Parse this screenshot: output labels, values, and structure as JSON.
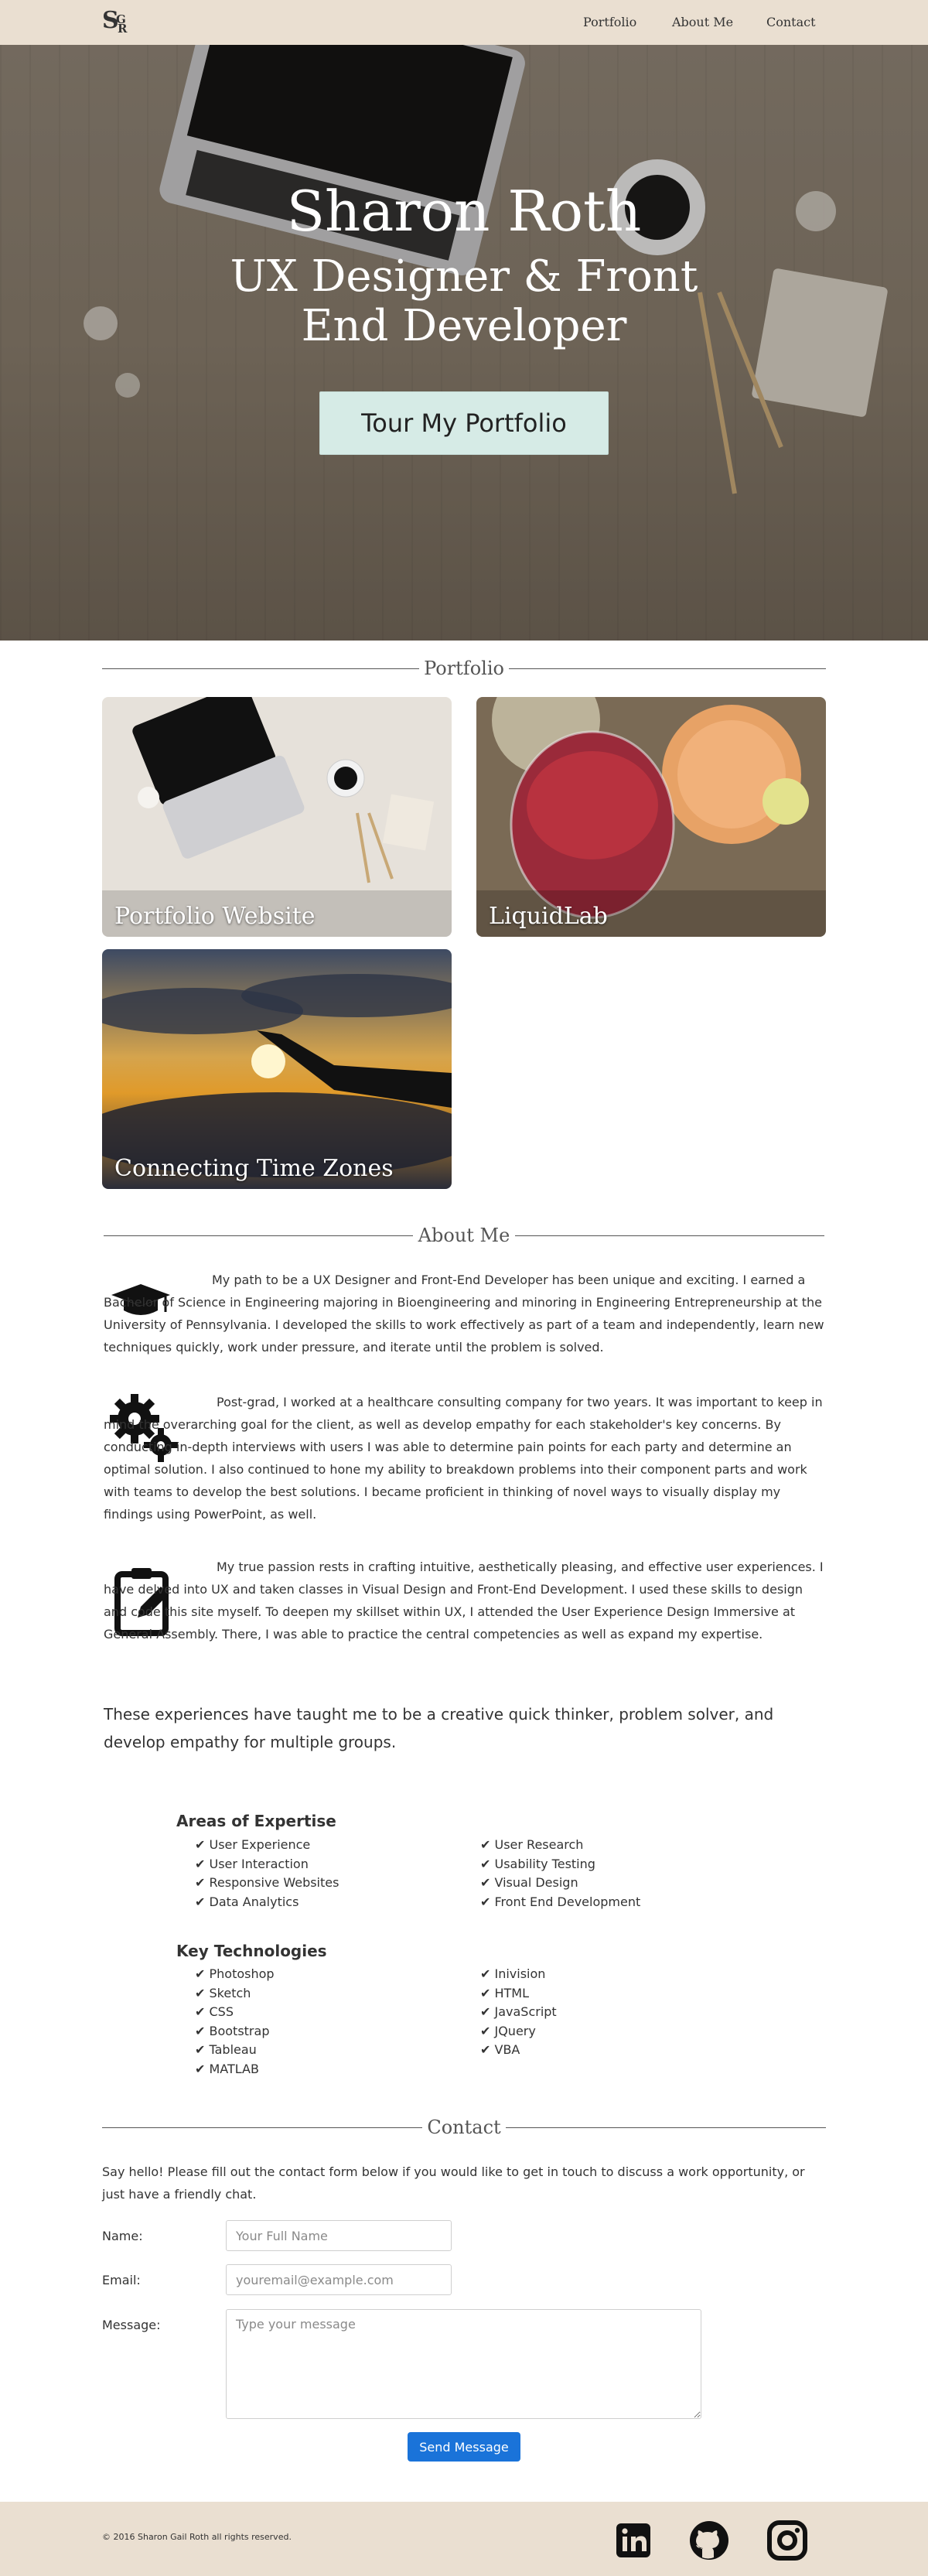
{
  "header": {
    "logo_letters": [
      "S",
      "G",
      "R"
    ],
    "nav": [
      "Portfolio",
      "About Me",
      "Contact"
    ]
  },
  "hero": {
    "title": "Sharon Roth",
    "subtitle": "UX Designer & Front End Developer",
    "button": "Tour My Portfolio"
  },
  "portfolio": {
    "heading": "Portfolio",
    "items": [
      "Portfolio Website",
      "LiquidLab",
      "Connecting Time Zones"
    ]
  },
  "about": {
    "heading": "About Me",
    "paragraphs": [
      "My path to be a UX Designer and Front-End Developer has been unique and exciting. I earned a Bachelor of Science in Engineering majoring in Bioengineering and minoring in Engineering Entrepreneurship at the University of Pennsylvania. I developed the skills to work effectively as part of a team and independently, learn new techniques quickly, work under pressure, and iterate until the problem is solved.",
      "Post-grad, I worked at a healthcare consulting company for two years. It was important to keep in mind the overarching goal for the client, as well as develop empathy for each stakeholder's key concerns. By conducting in-depth interviews with users I was able to determine pain points for each party and determine an optimal solution. I also continued to hone my ability to breakdown problems into their component parts and work with teams to develop the best solutions. I became proficient in thinking of novel ways to visually display my findings using PowerPoint, as well.",
      "My true passion rests in crafting intuitive, aesthetically pleasing, and effective user experiences. I have delved into UX and taken classes in Visual Design and Front-End Development. I used these skills to design and code this site myself. To deepen my skillset within UX, I attended the User Experience Design Immersive at General Assembly. There, I was able to practice the central competencies as well as expand my expertise."
    ],
    "summary": "These experiences have taught me to be a creative quick thinker, problem solver, and develop empathy for multiple groups.",
    "expertise_heading": "Areas of Expertise",
    "expertise_left": [
      "✔ User Experience",
      "✔ User Interaction",
      "✔ Responsive Websites",
      "✔ Data Analytics"
    ],
    "expertise_right": [
      "✔ User Research",
      "✔ Usability Testing",
      "✔ Visual Design",
      "✔ Front End Development"
    ],
    "tech_heading": "Key Technologies",
    "tech_left": [
      "✔ Photoshop",
      "✔ Sketch",
      "✔ CSS",
      "✔ Bootstrap",
      "✔ Tableau",
      "✔ MATLAB"
    ],
    "tech_right": [
      "✔ Inivision",
      "✔ HTML",
      "✔ JavaScript",
      "✔ JQuery",
      "✔ VBA"
    ]
  },
  "contact": {
    "heading": "Contact",
    "intro": "Say hello! Please fill out the contact form below if you would like to get in touch to discuss a work opportunity, or just have a friendly chat.",
    "name_label": "Name:",
    "name_placeholder": "Your Full Name",
    "email_label": "Email:",
    "email_placeholder": "youremail@example.com",
    "message_label": "Message:",
    "message_placeholder": "Type your message",
    "send_button": "Send Message"
  },
  "footer": {
    "copyright": "© 2016 Sharon Gail Roth all rights reserved.",
    "social_icons": [
      "linkedin-icon",
      "github-icon",
      "instagram-icon"
    ]
  },
  "colors": {
    "header_bg": "#eadfd1",
    "button_bg": "#d6ebe6",
    "send_button_bg": "#1a73d9"
  }
}
